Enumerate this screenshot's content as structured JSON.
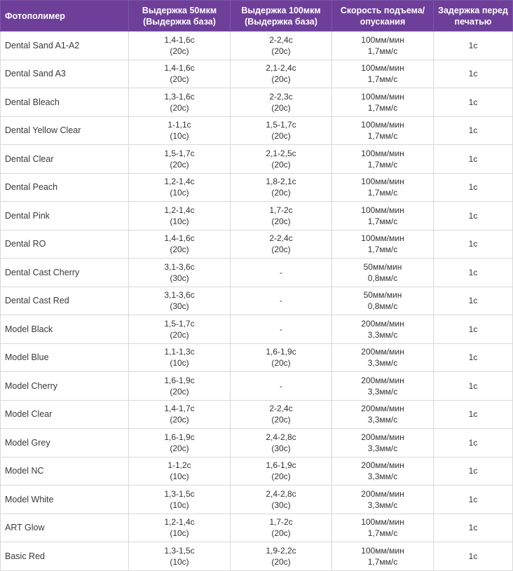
{
  "colors": {
    "header_bg": "#6d3f99",
    "header_text": "#ffffff",
    "border": "#d9d9d9",
    "cell_text": "#333333"
  },
  "columns": [
    [
      "Фотополимер"
    ],
    [
      "Выдержка 50мкм",
      "(Выдержка база)"
    ],
    [
      "Выдержка 100мкм",
      "(Выдержка база)"
    ],
    [
      "Скорость подъема/",
      "опускания"
    ],
    [
      "Задержка перед",
      "печатью"
    ]
  ],
  "rows": [
    {
      "name": "Dental Sand A1-A2",
      "exp50": [
        "1,4-1,6с",
        "(20с)"
      ],
      "exp100": [
        "2-2,4с",
        "(20с)"
      ],
      "speed": [
        "100мм/мин",
        "1,7мм/с"
      ],
      "delay": "1с"
    },
    {
      "name": "Dental Sand A3",
      "exp50": [
        "1,4-1,6с",
        "(20с)"
      ],
      "exp100": [
        "2,1-2,4с",
        "(20с)"
      ],
      "speed": [
        "100мм/мин",
        "1,7мм/с"
      ],
      "delay": "1с"
    },
    {
      "name": "Dental Bleach",
      "exp50": [
        "1,3-1,6с",
        "(20с)"
      ],
      "exp100": [
        "2-2,3с",
        "(20с)"
      ],
      "speed": [
        "100мм/мин",
        "1,7мм/с"
      ],
      "delay": "1с"
    },
    {
      "name": "Dental Yellow Clear",
      "exp50": [
        "1-1,1с",
        "(10с)"
      ],
      "exp100": [
        "1,5-1,7с",
        "(20с)"
      ],
      "speed": [
        "100мм/мин",
        "1,7мм/с"
      ],
      "delay": "1с"
    },
    {
      "name": "Dental Clear",
      "exp50": [
        "1,5-1,7с",
        "(20с)"
      ],
      "exp100": [
        "2,1-2,5с",
        "(20с)"
      ],
      "speed": [
        "100мм/мин",
        "1,7мм/с"
      ],
      "delay": "1с"
    },
    {
      "name": "Dental Peach",
      "exp50": [
        "1,2-1,4с",
        "(10с)"
      ],
      "exp100": [
        "1,8-2,1с",
        "(20с)"
      ],
      "speed": [
        "100мм/мин",
        "1,7мм/с"
      ],
      "delay": "1с"
    },
    {
      "name": "Dental Pink",
      "exp50": [
        "1,2-1,4с",
        "(10с)"
      ],
      "exp100": [
        "1,7-2с",
        "(20с)"
      ],
      "speed": [
        "100мм/мин",
        "1,7мм/с"
      ],
      "delay": "1с"
    },
    {
      "name": "Dental RO",
      "exp50": [
        "1,4-1,6с",
        "(20с)"
      ],
      "exp100": [
        "2-2,4с",
        "(20с)"
      ],
      "speed": [
        "100мм/мин",
        "1,7мм/с"
      ],
      "delay": "1с"
    },
    {
      "name": "Dental Cast Cherry",
      "exp50": [
        "3,1-3,6с",
        "(30с)"
      ],
      "exp100": [
        "-"
      ],
      "speed": [
        "50мм/мин",
        "0,8мм/с"
      ],
      "delay": "1с"
    },
    {
      "name": "Dental Cast Red",
      "exp50": [
        "3,1-3,6с",
        "(30с)"
      ],
      "exp100": [
        "-"
      ],
      "speed": [
        "50мм/мин",
        "0,8мм/с"
      ],
      "delay": "1с"
    },
    {
      "name": "Model Black",
      "exp50": [
        "1,5-1,7с",
        "(20с)"
      ],
      "exp100": [
        "-"
      ],
      "speed": [
        "200мм/мин",
        "3,3мм/с"
      ],
      "delay": "1с"
    },
    {
      "name": "Model Blue",
      "exp50": [
        "1,1-1,3с",
        "(10с)"
      ],
      "exp100": [
        "1,6-1,9с",
        "(20с)"
      ],
      "speed": [
        "200мм/мин",
        "3,3мм/с"
      ],
      "delay": "1с"
    },
    {
      "name": "Model Cherry",
      "exp50": [
        "1,6-1,9с",
        "(20с)"
      ],
      "exp100": [
        "-"
      ],
      "speed": [
        "200мм/мин",
        "3,3мм/с"
      ],
      "delay": "1с"
    },
    {
      "name": "Model Clear",
      "exp50": [
        "1,4-1,7с",
        "(20с)"
      ],
      "exp100": [
        "2-2,4с",
        "(20с)"
      ],
      "speed": [
        "200мм/мин",
        "3,3мм/с"
      ],
      "delay": "1с"
    },
    {
      "name": "Model Grey",
      "exp50": [
        "1,6-1,9с",
        "(20с)"
      ],
      "exp100": [
        "2,4-2,8с",
        "(30с)"
      ],
      "speed": [
        "200мм/мин",
        "3,3мм/с"
      ],
      "delay": "1с"
    },
    {
      "name": "Model NC",
      "exp50": [
        "1-1,2с",
        "(10с)"
      ],
      "exp100": [
        "1,6-1,9с",
        "(20с)"
      ],
      "speed": [
        "200мм/мин",
        "3,3мм/с"
      ],
      "delay": "1с"
    },
    {
      "name": "Model White",
      "exp50": [
        "1,3-1,5с",
        "(10с)"
      ],
      "exp100": [
        "2,4-2,8с",
        "(30с)"
      ],
      "speed": [
        "200мм/мин",
        "3,3мм/с"
      ],
      "delay": "1с"
    },
    {
      "name": "ART Glow",
      "exp50": [
        "1,2-1,4с",
        "(10с)"
      ],
      "exp100": [
        "1,7-2с",
        "(20с)"
      ],
      "speed": [
        "100мм/мин",
        "1,7мм/с"
      ],
      "delay": "1с"
    },
    {
      "name": "Basic Red",
      "exp50": [
        "1,3-1,5с",
        "(10с)"
      ],
      "exp100": [
        "1,9-2,2с",
        "(20с)"
      ],
      "speed": [
        "100мм/мин",
        "1,7мм/с"
      ],
      "delay": "1с"
    }
  ]
}
